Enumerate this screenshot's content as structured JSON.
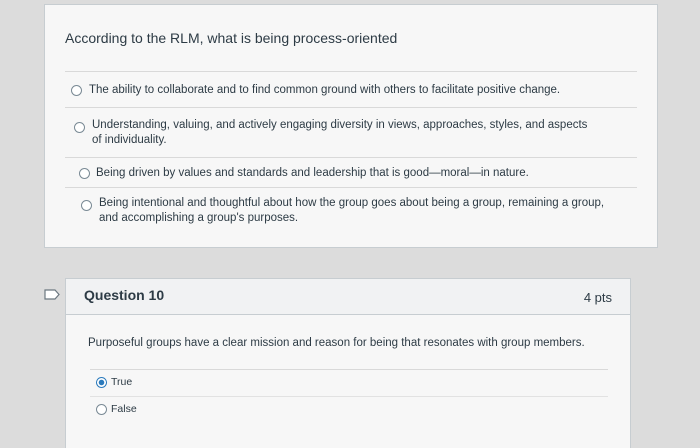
{
  "question9": {
    "text": "According to the RLM, what is being process-oriented",
    "answers": [
      {
        "label": "The ability to collaborate and to find common ground with others to facilitate positive change.",
        "selected": false
      },
      {
        "label": "Understanding, valuing, and actively engaging diversity in views, approaches, styles, and aspects of individuality.",
        "selected": false
      },
      {
        "label": "Being driven by values and standards and leadership that is good—moral—in nature.",
        "selected": false
      },
      {
        "label": "Being intentional and thoughtful about how the group goes about being a group, remaining a group, and accomplishing a group's purposes.",
        "selected": false
      }
    ]
  },
  "question10": {
    "title": "Question 10",
    "points": "4 pts",
    "text": "Purposeful groups have a clear mission and reason for being that resonates with group members.",
    "options": [
      {
        "label": "True",
        "selected": true
      },
      {
        "label": "False",
        "selected": false
      }
    ]
  },
  "colors": {
    "accent": "#2b7abc",
    "text": "#2d3b45",
    "border": "#c7cdd1"
  },
  "icons": {
    "flag": "bookmark-flag-icon",
    "radio": "radio-button-icon"
  }
}
